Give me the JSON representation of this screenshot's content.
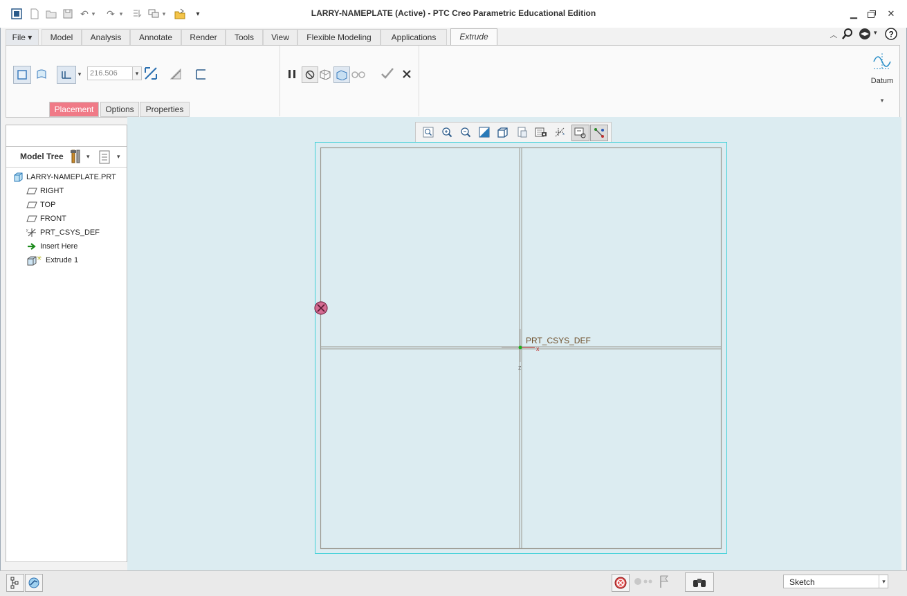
{
  "window": {
    "title": "LARRY-NAMEPLATE (Active) - PTC Creo Parametric Educational Edition"
  },
  "quick_access": {
    "icons": [
      "new-icon",
      "open-icon",
      "save-icon",
      "undo-icon",
      "redo-icon",
      "regenerate-icon",
      "windows-icon",
      "close-window-icon",
      "customize-icon"
    ]
  },
  "ribbon": {
    "tabs": [
      {
        "label": "File ▾"
      },
      {
        "label": "Model"
      },
      {
        "label": "Analysis"
      },
      {
        "label": "Annotate"
      },
      {
        "label": "Render"
      },
      {
        "label": "Tools"
      },
      {
        "label": "View"
      },
      {
        "label": "Flexible Modeling"
      },
      {
        "label": "Applications"
      },
      {
        "label": "Extrude"
      }
    ],
    "active_tab": "Extrude",
    "depth_value": "216.506",
    "datum_label": "Datum",
    "subtabs": [
      {
        "label": "Placement"
      },
      {
        "label": "Options"
      },
      {
        "label": "Properties"
      }
    ],
    "accent_color": "#f07a87"
  },
  "model_tree": {
    "title": "Model Tree",
    "items": [
      {
        "label": "LARRY-NAMEPLATE.PRT",
        "icon": "part-icon"
      },
      {
        "label": "RIGHT",
        "icon": "datum-plane-icon"
      },
      {
        "label": "TOP",
        "icon": "datum-plane-icon"
      },
      {
        "label": "FRONT",
        "icon": "datum-plane-icon"
      },
      {
        "label": "PRT_CSYS_DEF",
        "icon": "csys-icon"
      },
      {
        "label": "Insert Here",
        "icon": "arrow-right-icon"
      },
      {
        "label": "Extrude 1",
        "icon": "extrude-icon"
      }
    ]
  },
  "graphics": {
    "csys_label": "PRT_CSYS_DEF",
    "axis_x": "x",
    "axis_z": "z",
    "background": "#dcecf1"
  },
  "status": {
    "selection_filter": "Sketch"
  }
}
